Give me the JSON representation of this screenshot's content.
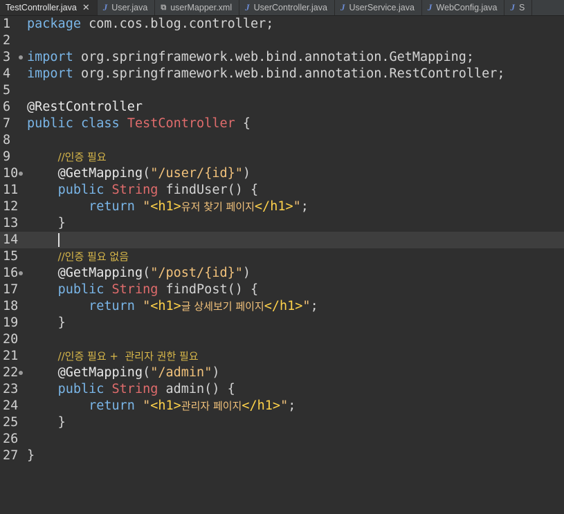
{
  "tabs": [
    {
      "label": "TestController.java",
      "icon": "java-file-icon",
      "active": true,
      "close": "✕"
    },
    {
      "label": "User.java",
      "icon": "java-file-icon"
    },
    {
      "label": "userMapper.xml",
      "icon": "xml-file-icon"
    },
    {
      "label": "UserController.java",
      "icon": "java-file-icon"
    },
    {
      "label": "UserService.java",
      "icon": "java-file-icon"
    },
    {
      "label": "WebConfig.java",
      "icon": "java-file-icon"
    },
    {
      "label": "S",
      "icon": "java-file-icon"
    }
  ],
  "line_numbers": [
    "1",
    "2",
    "3",
    "4",
    "5",
    "6",
    "7",
    "8",
    "9",
    "10",
    "11",
    "12",
    "13",
    "14",
    "15",
    "16",
    "17",
    "18",
    "19",
    "20",
    "21",
    "22",
    "23",
    "24",
    "25",
    "26",
    "27"
  ],
  "code": {
    "l1": {
      "kw": "package",
      "rest": " com.cos.blog.controller;"
    },
    "l3": {
      "kw": "import",
      "rest": " org.springframework.web.bind.annotation.GetMapping;"
    },
    "l4": {
      "kw": "import",
      "rest": " org.springframework.web.bind.annotation.RestController;"
    },
    "l6": {
      "ann": "@RestController"
    },
    "l7": {
      "kw1": "public",
      "kw2": "class",
      "cls": "TestController",
      "rest": " {"
    },
    "l9": {
      "cmt": "//인증 필요"
    },
    "l10": {
      "ann": "@GetMapping",
      "p1": "(",
      "str": "\"/user/{id}\"",
      "p2": ")"
    },
    "l11": {
      "kw": "public",
      "cls": "String",
      "rest": " findUser() {"
    },
    "l12": {
      "kw": "return",
      "q1": "\"",
      "tag1": "<h1>",
      "text": "유저 찾기 페이지",
      "tag2": "</h1>",
      "q2": "\"",
      "end": ";"
    },
    "l13": {
      "rest": "}"
    },
    "l15": {
      "cmt": "//인증 필요 없음"
    },
    "l16": {
      "ann": "@GetMapping",
      "p1": "(",
      "str": "\"/post/{id}\"",
      "p2": ")"
    },
    "l17": {
      "kw": "public",
      "cls": "String",
      "rest": " findPost() {"
    },
    "l18": {
      "kw": "return",
      "q1": "\"",
      "tag1": "<h1>",
      "text": "글 상세보기 페이지",
      "tag2": "</h1>",
      "q2": "\"",
      "end": ";"
    },
    "l19": {
      "rest": "}"
    },
    "l21": {
      "cmt": "//인증 필요 +  관리자 권한 필요"
    },
    "l22": {
      "ann": "@GetMapping",
      "p1": "(",
      "str": "\"/admin\"",
      "p2": ")"
    },
    "l23": {
      "kw": "public",
      "cls": "String",
      "rest": " admin() {"
    },
    "l24": {
      "kw": "return",
      "q1": "\"",
      "tag1": "<h1>",
      "text": "관리자 페이지",
      "tag2": "</h1>",
      "q2": "\"",
      "end": ";"
    },
    "l25": {
      "rest": "}"
    },
    "l27": {
      "rest": "}"
    }
  }
}
